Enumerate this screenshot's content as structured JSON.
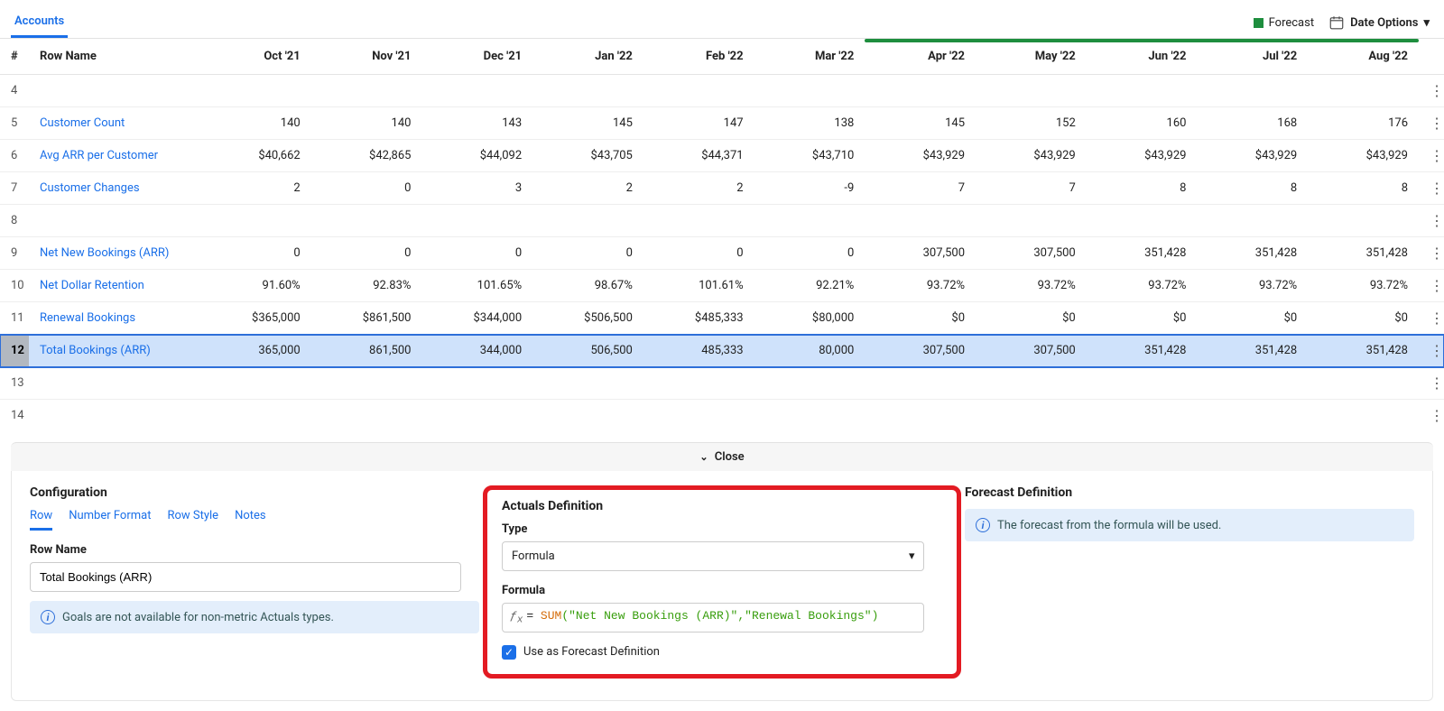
{
  "topbar": {
    "tab": "Accounts",
    "legend_forecast": "Forecast",
    "date_options": "Date Options"
  },
  "columns": [
    "Oct '21",
    "Nov '21",
    "Dec '21",
    "Jan '22",
    "Feb '22",
    "Mar '22",
    "Apr '22",
    "May '22",
    "Jun '22",
    "Jul '22",
    "Aug '22"
  ],
  "headers": {
    "num": "#",
    "name": "Row Name"
  },
  "forecast_start_col": 6,
  "rows": [
    {
      "num": "4",
      "name": "",
      "vals": [
        "",
        "",
        "",
        "",
        "",
        "",
        "",
        "",
        "",
        "",
        ""
      ],
      "link": false
    },
    {
      "num": "5",
      "name": "Customer Count",
      "vals": [
        "140",
        "140",
        "143",
        "145",
        "147",
        "138",
        "145",
        "152",
        "160",
        "168",
        "176"
      ],
      "link": true
    },
    {
      "num": "6",
      "name": "Avg ARR per Customer",
      "vals": [
        "$40,662",
        "$42,865",
        "$44,092",
        "$43,705",
        "$44,371",
        "$43,710",
        "$43,929",
        "$43,929",
        "$43,929",
        "$43,929",
        "$43,929"
      ],
      "link": true
    },
    {
      "num": "7",
      "name": "Customer Changes",
      "vals": [
        "2",
        "0",
        "3",
        "2",
        "2",
        "-9",
        "7",
        "7",
        "8",
        "8",
        "8"
      ],
      "link": true
    },
    {
      "num": "8",
      "name": "",
      "vals": [
        "",
        "",
        "",
        "",
        "",
        "",
        "",
        "",
        "",
        "",
        ""
      ],
      "link": false
    },
    {
      "num": "9",
      "name": "Net New Bookings (ARR)",
      "vals": [
        "0",
        "0",
        "0",
        "0",
        "0",
        "0",
        "307,500",
        "307,500",
        "351,428",
        "351,428",
        "351,428"
      ],
      "link": true
    },
    {
      "num": "10",
      "name": "Net Dollar Retention",
      "vals": [
        "91.60%",
        "92.83%",
        "101.65%",
        "98.67%",
        "101.61%",
        "92.21%",
        "93.72%",
        "93.72%",
        "93.72%",
        "93.72%",
        "93.72%"
      ],
      "link": true
    },
    {
      "num": "11",
      "name": "Renewal Bookings",
      "vals": [
        "$365,000",
        "$861,500",
        "$344,000",
        "$506,500",
        "$485,333",
        "$80,000",
        "$0",
        "$0",
        "$0",
        "$0",
        "$0"
      ],
      "link": true
    },
    {
      "num": "12",
      "name": "Total Bookings (ARR)",
      "vals": [
        "365,000",
        "861,500",
        "344,000",
        "506,500",
        "485,333",
        "80,000",
        "307,500",
        "307,500",
        "351,428",
        "351,428",
        "351,428"
      ],
      "link": true,
      "selected": true
    },
    {
      "num": "13",
      "name": "",
      "vals": [
        "",
        "",
        "",
        "",
        "",
        "",
        "",
        "",
        "",
        "",
        ""
      ],
      "link": false
    },
    {
      "num": "14",
      "name": "",
      "vals": [
        "",
        "",
        "",
        "",
        "",
        "",
        "",
        "",
        "",
        "",
        ""
      ],
      "link": false
    }
  ],
  "panel": {
    "close": "Close",
    "config_title": "Configuration",
    "tabs": [
      "Row",
      "Number Format",
      "Row Style",
      "Notes"
    ],
    "row_name_label": "Row Name",
    "row_name_value": "Total Bookings (ARR)",
    "config_banner": "Goals are not available for non-metric Actuals types.",
    "actuals_title": "Actuals Definition",
    "type_label": "Type",
    "type_value": "Formula",
    "formula_label": "Formula",
    "formula_fn": "SUM",
    "formula_args": "(\"Net New Bookings (ARR)\",\"Renewal Bookings\")",
    "use_forecast": "Use as Forecast Definition",
    "forecast_title": "Forecast Definition",
    "forecast_banner": "The forecast from the formula will be used."
  }
}
